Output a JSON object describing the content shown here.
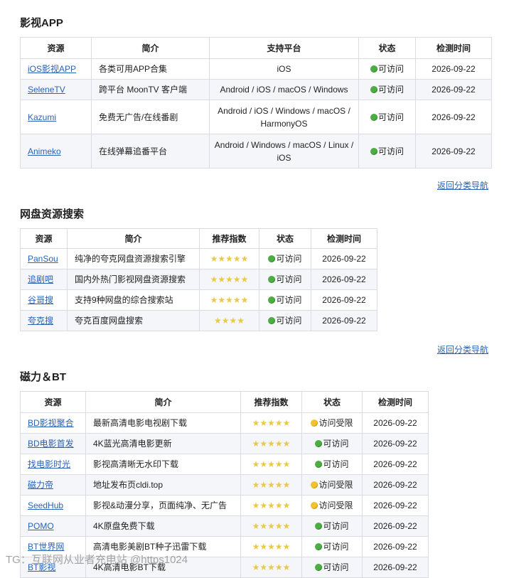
{
  "sections": {
    "apps": {
      "title": "影视APP",
      "headers": [
        "资源",
        "简介",
        "支持平台",
        "状态",
        "检测时间"
      ],
      "rows": [
        {
          "name": "iOS影视APP",
          "desc": "各类可用APP合集",
          "platform": "iOS",
          "status": "可访问",
          "status_color": "green",
          "date": "2026-09-22"
        },
        {
          "name": "SeleneTV",
          "desc": "跨平台 MoonTV 客户端",
          "platform": "Android / iOS / macOS / Windows",
          "status": "可访问",
          "status_color": "green",
          "date": "2026-09-22"
        },
        {
          "name": "Kazumi",
          "desc": "免费无广告/在线番剧",
          "platform": "Android / iOS / Windows / macOS / HarmonyOS",
          "status": "可访问",
          "status_color": "green",
          "date": "2026-09-22"
        },
        {
          "name": "Animeko",
          "desc": "在线弹幕追番平台",
          "platform": "Android / Windows / macOS / Linux / iOS",
          "status": "可访问",
          "status_color": "green",
          "date": "2026-09-22"
        }
      ],
      "back_link": "返回分类导航"
    },
    "cloud": {
      "title": "网盘资源搜索",
      "headers": [
        "资源",
        "简介",
        "推荐指数",
        "状态",
        "检测时间"
      ],
      "rows": [
        {
          "name": "PanSou",
          "desc": "纯净的夸克网盘资源搜索引擎",
          "rating": 5,
          "stars": "★★★★★",
          "status": "可访问",
          "status_color": "green",
          "date": "2026-09-22"
        },
        {
          "name": "追剧吧",
          "desc": "国内外热门影视网盘资源搜索",
          "rating": 5,
          "stars": "★★★★★",
          "status": "可访问",
          "status_color": "green",
          "date": "2026-09-22"
        },
        {
          "name": "谷哥搜",
          "desc": "支持9种网盘的综合搜索站",
          "rating": 5,
          "stars": "★★★★★",
          "status": "可访问",
          "status_color": "green",
          "date": "2026-09-22"
        },
        {
          "name": "夸克搜",
          "desc": "夸克百度网盘搜索",
          "rating": 4,
          "stars": "★★★★",
          "status": "可访问",
          "status_color": "green",
          "date": "2026-09-22"
        }
      ],
      "back_link": "返回分类导航"
    },
    "bt": {
      "title": "磁力＆BT",
      "headers": [
        "资源",
        "简介",
        "推荐指数",
        "状态",
        "检测时间"
      ],
      "rows": [
        {
          "name": "BD影视聚合",
          "desc": "最新高清电影电视剧下载",
          "rating": 5,
          "stars": "★★★★★",
          "status": "访问受限",
          "status_color": "yellow",
          "date": "2026-09-22"
        },
        {
          "name": "BD电影首发",
          "desc": "4K蓝光高清电影更新",
          "rating": 5,
          "stars": "★★★★★",
          "status": "可访问",
          "status_color": "green",
          "date": "2026-09-22"
        },
        {
          "name": "找电影时光",
          "desc": "影视高清晰无水印下载",
          "rating": 5,
          "stars": "★★★★★",
          "status": "可访问",
          "status_color": "green",
          "date": "2026-09-22"
        },
        {
          "name": "磁力帝",
          "desc": "地址发布页cldi.top",
          "rating": 5,
          "stars": "★★★★★",
          "status": "访问受限",
          "status_color": "yellow",
          "date": "2026-09-22"
        },
        {
          "name": "SeedHub",
          "desc": "影视&动漫分享，页面纯净、无广告",
          "rating": 5,
          "stars": "★★★★★",
          "status": "访问受限",
          "status_color": "yellow",
          "date": "2026-09-22"
        },
        {
          "name": "POMO",
          "desc": "4K原盘免费下载",
          "rating": 5,
          "stars": "★★★★★",
          "status": "可访问",
          "status_color": "green",
          "date": "2026-09-22"
        },
        {
          "name": "BT世界网",
          "desc": "高清电影美剧BT种子迅雷下载",
          "rating": 5,
          "stars": "★★★★★",
          "status": "可访问",
          "status_color": "green",
          "date": "2026-09-22"
        },
        {
          "name": "BT影视",
          "desc": "4K高清电影BT下载",
          "rating": 5,
          "stars": "★★★★★",
          "status": "可访问",
          "status_color": "green",
          "date": "2026-09-22"
        }
      ]
    }
  },
  "watermark": "TG：互联网从业者充电站 @https1024"
}
